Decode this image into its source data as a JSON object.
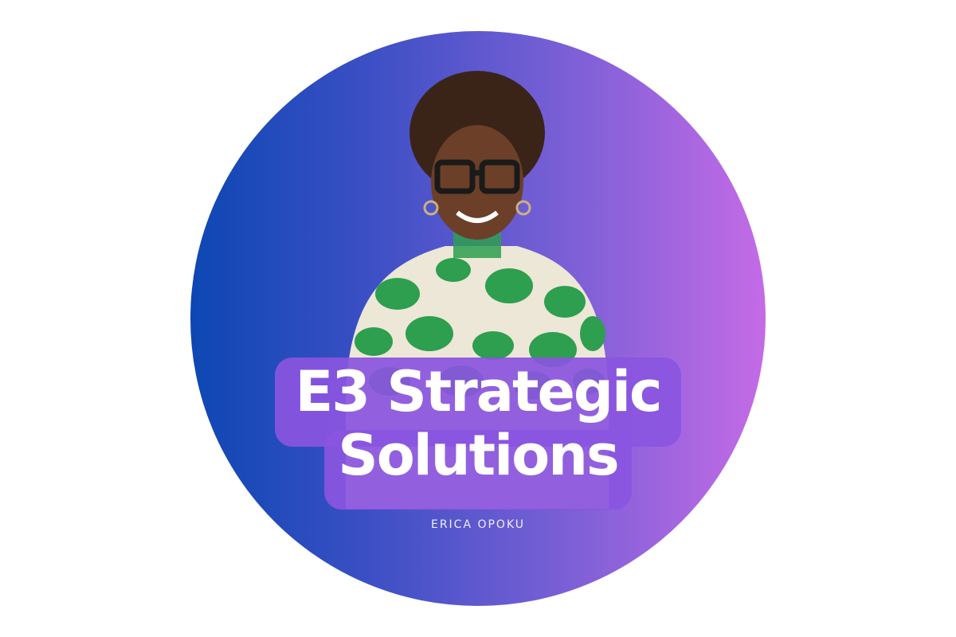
{
  "brand": {
    "title_line1": "E3 Strategic",
    "title_line2": "Solutions",
    "subtitle": "ERICA OPOKU"
  },
  "colors": {
    "gradient_start": "#0d47b3",
    "gradient_end": "#c46be6",
    "title_highlight": "#8a55e0",
    "text": "#ffffff",
    "shirt_green": "#2e9e4f",
    "shirt_cream": "#ece7d6"
  }
}
